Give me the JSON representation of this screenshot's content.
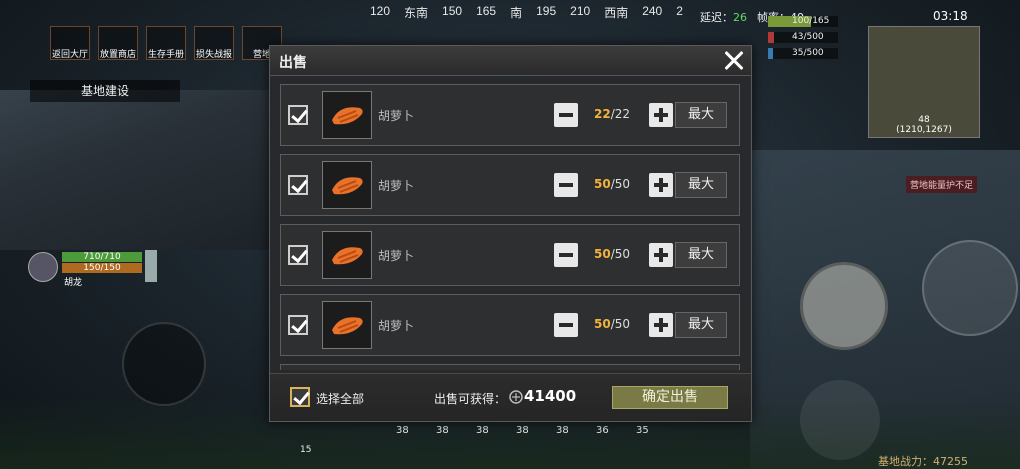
{
  "hud": {
    "compass": [
      "120",
      "东南",
      "150",
      "165",
      "南",
      "195",
      "210",
      "西南",
      "240",
      "2"
    ],
    "latency_label": "延迟：",
    "latency_value": "26",
    "fps_label": "帧率：",
    "fps_value": "40",
    "clock": "03:18",
    "stats": [
      "100/165",
      "43/500",
      "35/500"
    ],
    "top_menu": [
      "返回大厅",
      "放置商店",
      "生存手册",
      "损失战报",
      "营地"
    ],
    "base_build": "基地建设",
    "player": {
      "hp": "710/710",
      "sp": "150/150",
      "name": "胡龙"
    },
    "minimap": {
      "zone": "48",
      "coords": "(1210,1267)"
    },
    "warning": "营地能量护不足",
    "hotbar": [
      "38",
      "38",
      "38",
      "38",
      "38",
      "36",
      "35"
    ],
    "hotbar_left": "15",
    "combat_power": "基地战力：47255"
  },
  "dialog": {
    "title": "出售",
    "items": [
      {
        "name": "胡萝卜",
        "qty": "22",
        "max_qty": "22",
        "max_label": "最大"
      },
      {
        "name": "胡萝卜",
        "qty": "50",
        "max_qty": "50",
        "max_label": "最大"
      },
      {
        "name": "胡萝卜",
        "qty": "50",
        "max_qty": "50",
        "max_label": "最大"
      },
      {
        "name": "胡萝卜",
        "qty": "50",
        "max_qty": "50",
        "max_label": "最大"
      }
    ],
    "select_all": "选择全部",
    "earn_label": "出售可获得：",
    "earn_value": "41400",
    "confirm": "确定出售"
  },
  "colors": {
    "qty_highlight": "#f4b23a",
    "confirm_bg": "#7a7a46"
  }
}
